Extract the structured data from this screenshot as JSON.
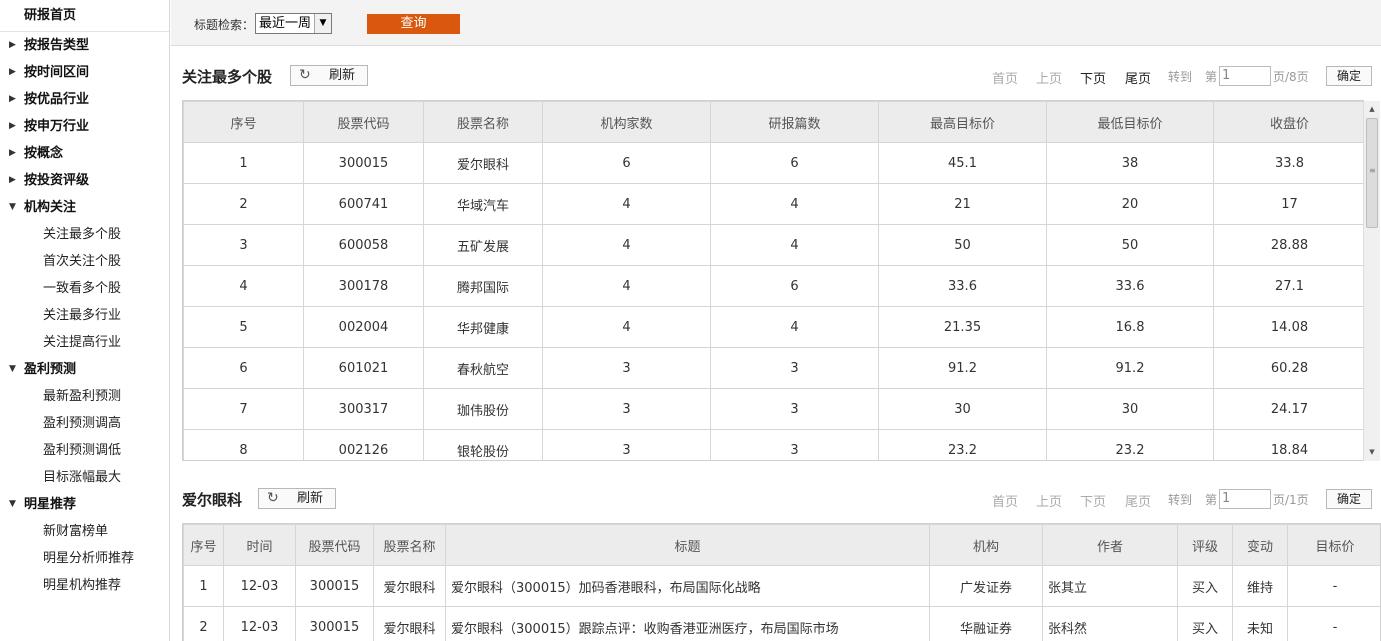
{
  "sidebar": {
    "home": "研报首页",
    "categories": [
      {
        "label": "按报告类型",
        "expanded": false,
        "items": []
      },
      {
        "label": "按时间区间",
        "expanded": false,
        "items": []
      },
      {
        "label": "按优品行业",
        "expanded": false,
        "items": []
      },
      {
        "label": "按申万行业",
        "expanded": false,
        "items": []
      },
      {
        "label": "按概念",
        "expanded": false,
        "items": []
      },
      {
        "label": "按投资评级",
        "expanded": false,
        "items": []
      },
      {
        "label": "机构关注",
        "expanded": true,
        "items": [
          "关注最多个股",
          "首次关注个股",
          "一致看多个股",
          "关注最多行业",
          "关注提高行业"
        ]
      },
      {
        "label": "盈利预测",
        "expanded": true,
        "items": [
          "最新盈利预测",
          "盈利预测调高",
          "盈利预测调低",
          "目标涨幅最大"
        ]
      },
      {
        "label": "明星推荐",
        "expanded": true,
        "items": [
          "新财富榜单",
          "明星分析师推荐",
          "明星机构推荐"
        ]
      }
    ]
  },
  "search": {
    "label": "标题检索：",
    "select_value": "最近一周",
    "query_button": "查询"
  },
  "section1": {
    "title": "关注最多个股",
    "refresh_label": "刷新",
    "pager": {
      "first": "首页",
      "prev": "上页",
      "next": "下页",
      "last": "尾页",
      "goto": "转到",
      "page_prefix": "第",
      "page_value": "1",
      "page_suffix": "页/8页",
      "ok": "确定"
    },
    "columns": [
      "序号",
      "股票代码",
      "股票名称",
      "机构家数",
      "研报篇数",
      "最高目标价",
      "最低目标价",
      "收盘价"
    ],
    "rows": [
      [
        "1",
        "300015",
        "爱尔眼科",
        "6",
        "6",
        "45.1",
        "38",
        "33.8"
      ],
      [
        "2",
        "600741",
        "华域汽车",
        "4",
        "4",
        "21",
        "20",
        "17"
      ],
      [
        "3",
        "600058",
        "五矿发展",
        "4",
        "4",
        "50",
        "50",
        "28.88"
      ],
      [
        "4",
        "300178",
        "腾邦国际",
        "4",
        "6",
        "33.6",
        "33.6",
        "27.1"
      ],
      [
        "5",
        "002004",
        "华邦健康",
        "4",
        "4",
        "21.35",
        "16.8",
        "14.08"
      ],
      [
        "6",
        "601021",
        "春秋航空",
        "3",
        "3",
        "91.2",
        "91.2",
        "60.28"
      ],
      [
        "7",
        "300317",
        "珈伟股份",
        "3",
        "3",
        "30",
        "30",
        "24.17"
      ],
      [
        "8",
        "002126",
        "银轮股份",
        "3",
        "3",
        "23.2",
        "23.2",
        "18.84"
      ]
    ]
  },
  "section2": {
    "title": "爱尔眼科",
    "refresh_label": "刷新",
    "pager": {
      "first": "首页",
      "prev": "上页",
      "next": "下页",
      "last": "尾页",
      "goto": "转到",
      "page_prefix": "第",
      "page_value": "1",
      "page_suffix": "页/1页",
      "ok": "确定"
    },
    "columns": [
      "序号",
      "时间",
      "股票代码",
      "股票名称",
      "标题",
      "机构",
      "作者",
      "评级",
      "变动",
      "目标价"
    ],
    "rows": [
      [
        "1",
        "12-03",
        "300015",
        "爱尔眼科",
        "爱尔眼科（300015）加码香港眼科，布局国际化战略",
        "广发证券",
        "张其立",
        "买入",
        "维持",
        "-"
      ],
      [
        "2",
        "12-03",
        "300015",
        "爱尔眼科",
        "爱尔眼科（300015）跟踪点评：收购香港亚洲医疗，布局国际市场",
        "华融证券",
        "张科然",
        "买入",
        "未知",
        "-"
      ]
    ]
  }
}
